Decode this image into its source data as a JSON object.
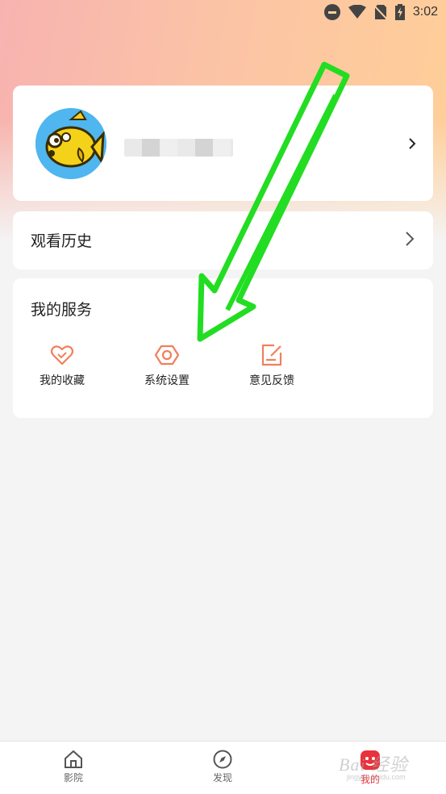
{
  "status_bar": {
    "time": "3:02"
  },
  "profile": {
    "chevron": "›"
  },
  "history": {
    "title": "观看历史"
  },
  "services": {
    "title": "我的服务",
    "items": [
      {
        "label": "我的收藏",
        "icon": "heart-icon"
      },
      {
        "label": "系统设置",
        "icon": "hexagon-settings-icon"
      },
      {
        "label": "意见反馈",
        "icon": "edit-note-icon"
      }
    ]
  },
  "bottom_nav": {
    "items": [
      {
        "label": "影院",
        "icon": "home-icon",
        "active": false
      },
      {
        "label": "发现",
        "icon": "compass-icon",
        "active": false
      },
      {
        "label": "我的",
        "icon": "profile-icon",
        "active": true
      }
    ]
  },
  "watermark": {
    "text": "Bai 经验",
    "sub": "jingyan.baidu.com"
  },
  "colors": {
    "accent": "#e8323c",
    "service_icon": "#f0805c",
    "annotation": "#22dd22"
  }
}
